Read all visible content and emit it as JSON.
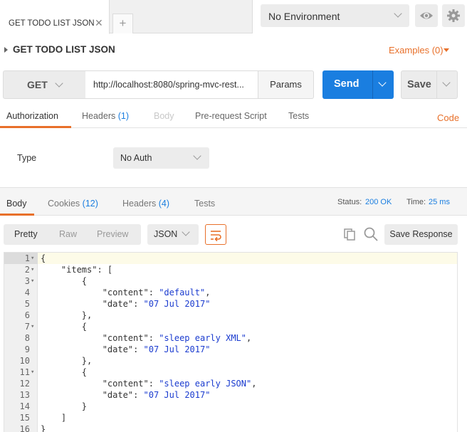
{
  "tabs": [
    {
      "label": "GET TODO LIST JSON"
    }
  ],
  "environment": {
    "selected": "No Environment"
  },
  "request": {
    "title": "GET TODO LIST JSON",
    "examples_label": "Examples (0)",
    "method": "GET",
    "url": "http://localhost:8080/spring-mvc-rest...",
    "params_label": "Params",
    "send_label": "Send",
    "save_label": "Save"
  },
  "request_tabs": {
    "authorization": "Authorization",
    "headers": "Headers",
    "headers_count": "(1)",
    "body": "Body",
    "prerequest": "Pre-request Script",
    "tests": "Tests",
    "code": "Code"
  },
  "auth": {
    "type_label": "Type",
    "selected": "No Auth"
  },
  "response_tabs": {
    "body": "Body",
    "cookies": "Cookies",
    "cookies_count": "(12)",
    "headers": "Headers",
    "headers_count": "(4)",
    "tests": "Tests"
  },
  "status": {
    "status_label": "Status:",
    "status_value": "200 OK",
    "time_label": "Time:",
    "time_value": "25 ms"
  },
  "toolbar": {
    "pretty": "Pretty",
    "raw": "Raw",
    "preview": "Preview",
    "lang": "JSON",
    "save_response": "Save Response"
  },
  "colors": {
    "accent": "#e8702a",
    "primary": "#1a7ee0"
  },
  "code_lines": [
    {
      "n": "1",
      "fold": true,
      "parts": [
        [
          "p",
          "{"
        ]
      ]
    },
    {
      "n": "2",
      "fold": true,
      "parts": [
        [
          "p",
          "    "
        ],
        [
          "k",
          "\"items\""
        ],
        [
          "p",
          ": ["
        ]
      ]
    },
    {
      "n": "3",
      "fold": true,
      "parts": [
        [
          "p",
          "        {"
        ]
      ]
    },
    {
      "n": "4",
      "fold": false,
      "parts": [
        [
          "p",
          "            "
        ],
        [
          "k",
          "\"content\""
        ],
        [
          "p",
          ": "
        ],
        [
          "s",
          "\"default\""
        ],
        [
          "p",
          ","
        ]
      ]
    },
    {
      "n": "5",
      "fold": false,
      "parts": [
        [
          "p",
          "            "
        ],
        [
          "k",
          "\"date\""
        ],
        [
          "p",
          ": "
        ],
        [
          "s",
          "\"07 Jul 2017\""
        ]
      ]
    },
    {
      "n": "6",
      "fold": false,
      "parts": [
        [
          "p",
          "        },"
        ]
      ]
    },
    {
      "n": "7",
      "fold": true,
      "parts": [
        [
          "p",
          "        {"
        ]
      ]
    },
    {
      "n": "8",
      "fold": false,
      "parts": [
        [
          "p",
          "            "
        ],
        [
          "k",
          "\"content\""
        ],
        [
          "p",
          ": "
        ],
        [
          "s",
          "\"sleep early XML\""
        ],
        [
          "p",
          ","
        ]
      ]
    },
    {
      "n": "9",
      "fold": false,
      "parts": [
        [
          "p",
          "            "
        ],
        [
          "k",
          "\"date\""
        ],
        [
          "p",
          ": "
        ],
        [
          "s",
          "\"07 Jul 2017\""
        ]
      ]
    },
    {
      "n": "10",
      "fold": false,
      "parts": [
        [
          "p",
          "        },"
        ]
      ]
    },
    {
      "n": "11",
      "fold": true,
      "parts": [
        [
          "p",
          "        {"
        ]
      ]
    },
    {
      "n": "12",
      "fold": false,
      "parts": [
        [
          "p",
          "            "
        ],
        [
          "k",
          "\"content\""
        ],
        [
          "p",
          ": "
        ],
        [
          "s",
          "\"sleep early JSON\""
        ],
        [
          "p",
          ","
        ]
      ]
    },
    {
      "n": "13",
      "fold": false,
      "parts": [
        [
          "p",
          "            "
        ],
        [
          "k",
          "\"date\""
        ],
        [
          "p",
          ": "
        ],
        [
          "s",
          "\"07 Jul 2017\""
        ]
      ]
    },
    {
      "n": "14",
      "fold": false,
      "parts": [
        [
          "p",
          "        }"
        ]
      ]
    },
    {
      "n": "15",
      "fold": false,
      "parts": [
        [
          "p",
          "    ]"
        ]
      ]
    },
    {
      "n": "16",
      "fold": false,
      "parts": [
        [
          "p",
          "}"
        ]
      ]
    }
  ]
}
